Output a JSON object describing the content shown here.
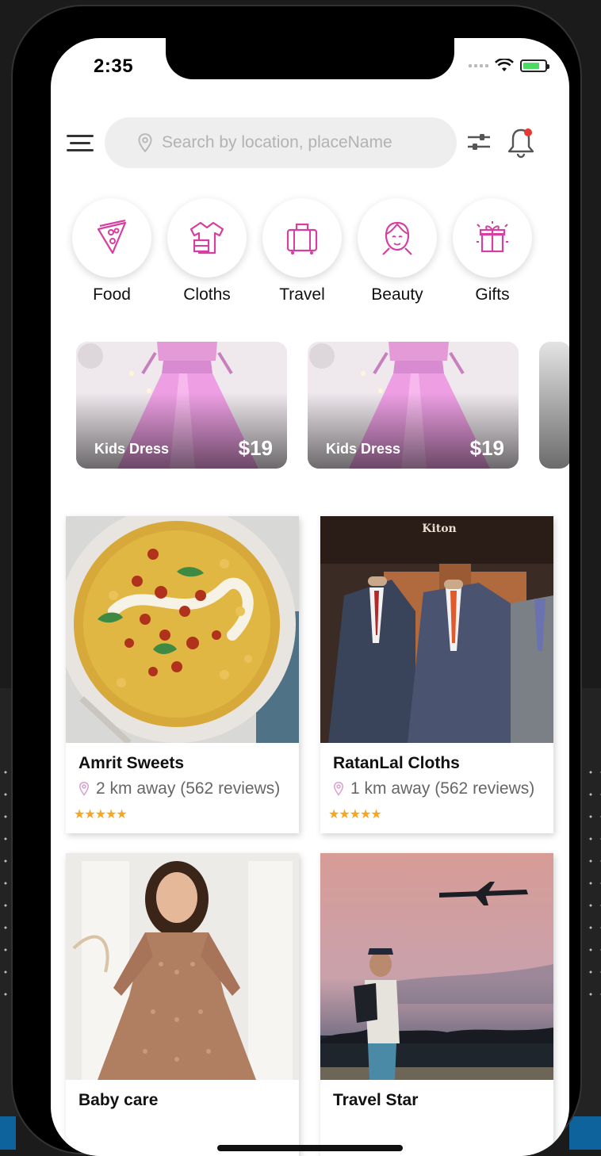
{
  "status": {
    "time": "2:35"
  },
  "search": {
    "placeholder": "Search by location, placeName"
  },
  "categories": [
    {
      "label": "Food",
      "icon": "pizza-icon"
    },
    {
      "label": "Cloths",
      "icon": "clothes-icon"
    },
    {
      "label": "Travel",
      "icon": "luggage-icon"
    },
    {
      "label": "Beauty",
      "icon": "face-icon"
    },
    {
      "label": "Gifts",
      "icon": "gift-icon"
    }
  ],
  "promos": [
    {
      "name": "Kids Dress",
      "price": "$19"
    },
    {
      "name": "Kids Dress",
      "price": "$19"
    }
  ],
  "stores": [
    {
      "title": "Amrit Sweets",
      "meta": "2 km away (562 reviews)",
      "stars": "★★★★★",
      "rating": 5
    },
    {
      "title": "RatanLal Cloths",
      "meta": "1 km away (562 reviews)",
      "stars": "★★★★★",
      "rating": 5
    },
    {
      "title": "Baby care",
      "meta": "",
      "stars": "",
      "rating": null
    },
    {
      "title": "Travel Star",
      "meta": "",
      "stars": "",
      "rating": null
    }
  ],
  "colors": {
    "accent": "#d63fa0",
    "star": "#f5a623",
    "notification_dot": "#e53935"
  }
}
